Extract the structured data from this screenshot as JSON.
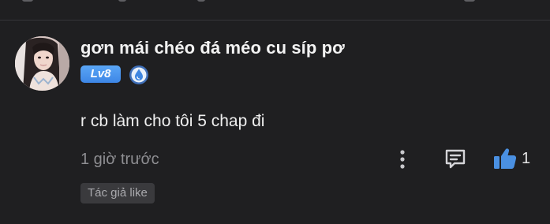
{
  "comment": {
    "username": "gơn mái chéo đá méo cu síp pơ",
    "level": "Lv8",
    "text": "r cb làm cho tôi 5 chap đi",
    "timestamp": "1 giờ trước",
    "like_count": "1",
    "author_like_label": "Tác giả like"
  },
  "icons": {
    "rank": "water-drop-rank-icon",
    "more": "more-vertical-icon",
    "reply": "comment-icon",
    "like": "thumbs-up-icon"
  },
  "colors": {
    "background": "#1f1f21",
    "accent": "#4a90e2",
    "level_badge": "#4a95ee",
    "muted_text": "#8e8e92"
  }
}
